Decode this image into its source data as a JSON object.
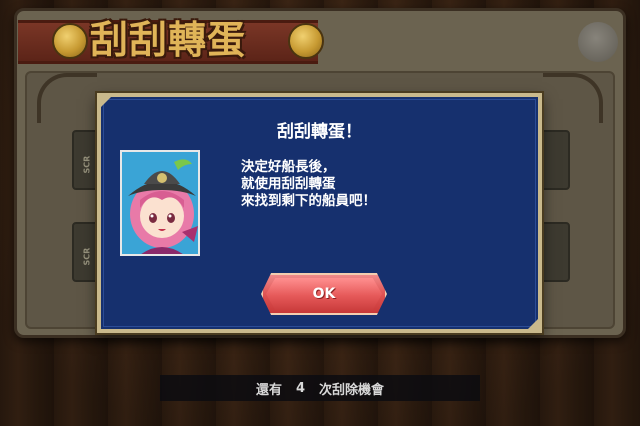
{
  "screen": {
    "banner_title": "刮刮轉蛋",
    "side_card_label": "SCR"
  },
  "dialog": {
    "title": "刮刮轉蛋！",
    "message_lines": [
      "決定好船長後，",
      "就使用刮刮轉蛋",
      "來找到剩下的船員吧！"
    ],
    "ok_label": "OK"
  },
  "status": {
    "prefix": "還有",
    "count": "4",
    "suffix": "次刮除機會"
  },
  "colors": {
    "dialog_bg": "#16306e",
    "dialog_border": "#c9b98c",
    "ok_button": "#e05454",
    "banner_text": "#e0b458"
  },
  "icons": [
    "coin-icon",
    "character-portrait",
    "corner-menu-icon"
  ]
}
